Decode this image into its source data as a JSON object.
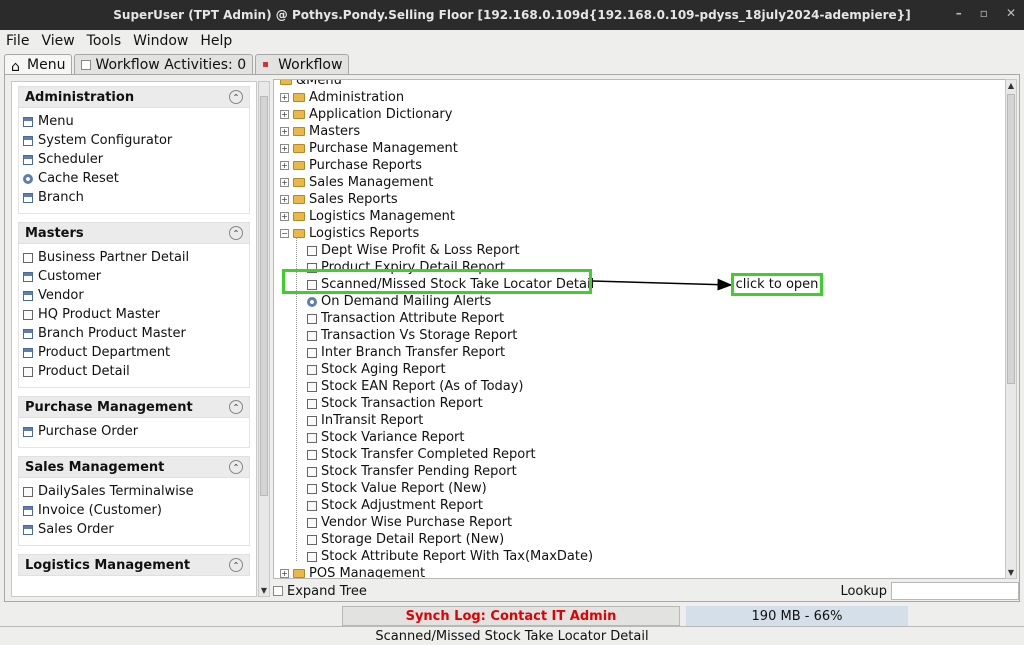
{
  "window": {
    "title": "SuperUser (TPT Admin) @ Pothys.Pondy.Selling Floor [192.168.0.109d{192.168.0.109-pdyss_18july2024-adempiere}]",
    "min": "–",
    "max": "▫",
    "close": "✕"
  },
  "menubar": [
    "File",
    "View",
    "Tools",
    "Window",
    "Help"
  ],
  "tabs": [
    {
      "label": "Menu"
    },
    {
      "label": "Workflow Activities: 0"
    },
    {
      "label": "Workflow"
    }
  ],
  "sidebar": {
    "sections": [
      {
        "title": "Administration",
        "items": [
          {
            "label": "Menu",
            "icon": "window"
          },
          {
            "label": "System Configurator",
            "icon": "window"
          },
          {
            "label": "Scheduler",
            "icon": "window"
          },
          {
            "label": "Cache Reset",
            "icon": "gear"
          },
          {
            "label": "Branch",
            "icon": "window"
          }
        ]
      },
      {
        "title": "Masters",
        "items": [
          {
            "label": "Business Partner Detail",
            "icon": "doc"
          },
          {
            "label": "Customer",
            "icon": "window"
          },
          {
            "label": "Vendor",
            "icon": "window"
          },
          {
            "label": "HQ Product Master",
            "icon": "doc"
          },
          {
            "label": "Branch Product Master",
            "icon": "window"
          },
          {
            "label": "Product Department",
            "icon": "window"
          },
          {
            "label": "Product Detail",
            "icon": "doc"
          }
        ]
      },
      {
        "title": "Purchase Management",
        "items": [
          {
            "label": "Purchase Order",
            "icon": "window"
          }
        ]
      },
      {
        "title": "Sales Management",
        "items": [
          {
            "label": "DailySales Terminalwise",
            "icon": "doc"
          },
          {
            "label": "Invoice (Customer)",
            "icon": "window"
          },
          {
            "label": "Sales Order",
            "icon": "window"
          }
        ]
      },
      {
        "title": "Logistics Management",
        "items": []
      }
    ]
  },
  "tree": {
    "root": "&Menu",
    "folders_top": [
      "Administration",
      "Application Dictionary",
      "Masters",
      "Purchase Management",
      "Purchase Reports",
      "Sales Management",
      "Sales Reports",
      "Logistics Management"
    ],
    "open_folder": "Logistics Reports",
    "children": [
      "Dept Wise Profit & Loss Report",
      "Product Expiry Detail Report",
      "Scanned/Missed Stock Take Locator Detail",
      "On Demand Mailing Alerts",
      "Transaction Attribute Report",
      "Transaction Vs Storage Report",
      "Inter Branch Transfer Report",
      "Stock Aging Report",
      "Stock EAN Report (As of Today)",
      "Stock Transaction Report",
      "InTransit Report",
      "Stock Variance Report",
      "Stock Transfer Completed Report",
      "Stock Transfer Pending Report",
      "Stock Value Report (New)",
      "Stock Adjustment Report",
      "Vendor Wise Purchase Report",
      "Storage Detail Report (New)",
      "Stock Attribute Report With Tax(MaxDate)"
    ],
    "folders_bottom": [
      "POS Management"
    ]
  },
  "bottom": {
    "expand_tree": "Expand Tree",
    "lookup": "Lookup"
  },
  "status": {
    "synch": "Synch Log: Contact IT Admin",
    "memory": "190 MB - 66%",
    "selected": "Scanned/Missed Stock Take Locator Detail"
  },
  "annotation": {
    "callout": "click to open",
    "color": "#3ecf2b"
  }
}
